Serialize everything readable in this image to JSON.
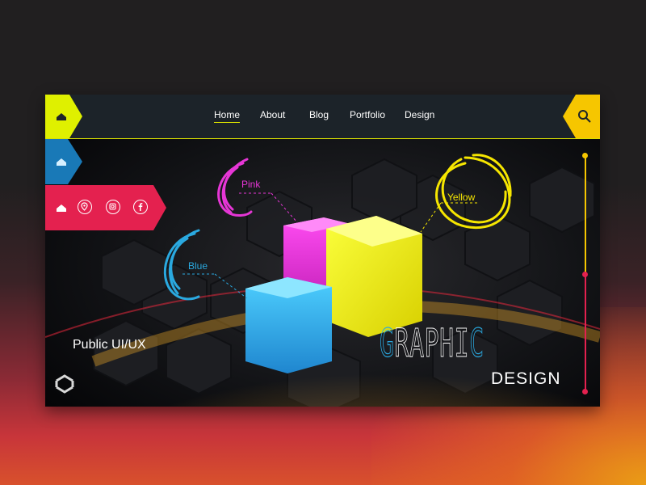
{
  "nav": {
    "items": [
      {
        "label": "Home",
        "active": true
      },
      {
        "label": "About",
        "active": false
      },
      {
        "label": "Blog",
        "active": false
      },
      {
        "label": "Portfolio",
        "active": false
      },
      {
        "label": "Design",
        "active": false
      }
    ]
  },
  "hero": {
    "tagline": "Public UI/UX",
    "title_letters": [
      "G",
      "R",
      "A",
      "P",
      "H",
      "I",
      "C"
    ],
    "subtitle": "DESIGN"
  },
  "labels": {
    "pink": "Pink",
    "blue": "Blue",
    "yellow": "Yellow"
  },
  "icons": {
    "home_tab": "home-icon",
    "search": "search-icon",
    "location": "location-pin-icon",
    "instagram": "instagram-icon",
    "facebook": "facebook-icon",
    "logo": "hexagon-logo-icon"
  },
  "colors": {
    "yellow": "#dff000",
    "blue": "#1979b7",
    "pink": "#e4214f",
    "magenta": "#e636d6",
    "cyan": "#2aa9e0",
    "gold": "#f6c600"
  }
}
